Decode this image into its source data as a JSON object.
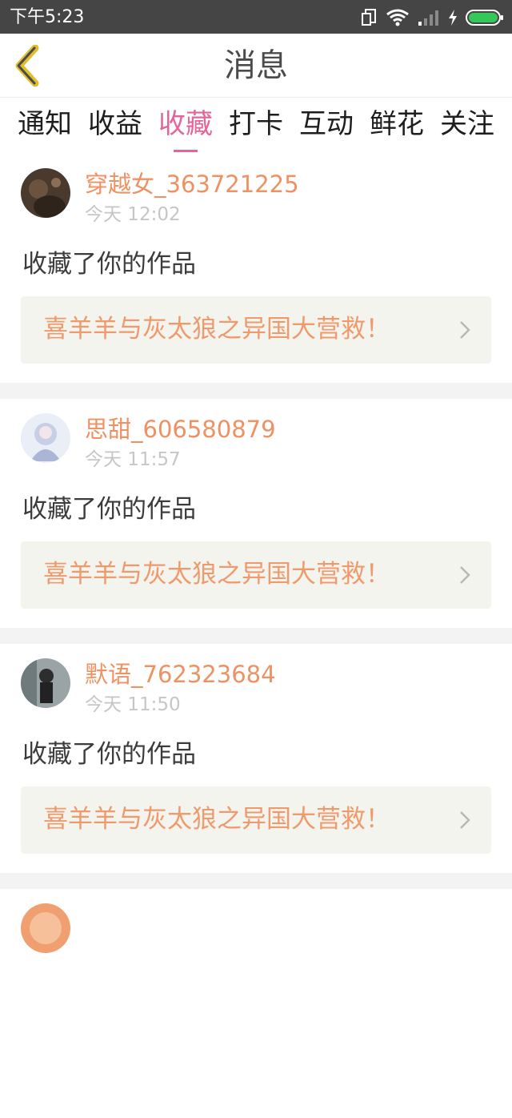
{
  "status_bar": {
    "time": "下午5:23"
  },
  "header": {
    "title": "消息"
  },
  "tabs": [
    {
      "label": "通知",
      "active": false
    },
    {
      "label": "收益",
      "active": false
    },
    {
      "label": "收藏",
      "active": true
    },
    {
      "label": "打卡",
      "active": false
    },
    {
      "label": "互动",
      "active": false
    },
    {
      "label": "鲜花",
      "active": false
    },
    {
      "label": "关注",
      "active": false
    }
  ],
  "notifications": [
    {
      "username": "穿越女_363721225",
      "time": "今天 12:02",
      "message": "收藏了你的作品",
      "work_title": "喜羊羊与灰太狼之异国大营救！"
    },
    {
      "username": "思甜_606580879",
      "time": "今天 11:57",
      "message": "收藏了你的作品",
      "work_title": "喜羊羊与灰太狼之异国大营救！"
    },
    {
      "username": "默语_762323684",
      "time": "今天 11:50",
      "message": "收藏了你的作品",
      "work_title": "喜羊羊与灰太狼之异国大营救！"
    }
  ],
  "colors": {
    "accent_pink": "#e6649a",
    "username_orange": "#ee9163",
    "link_orange": "#ef9a6c",
    "status_bar": "#454545",
    "battery_green": "#34c759"
  }
}
